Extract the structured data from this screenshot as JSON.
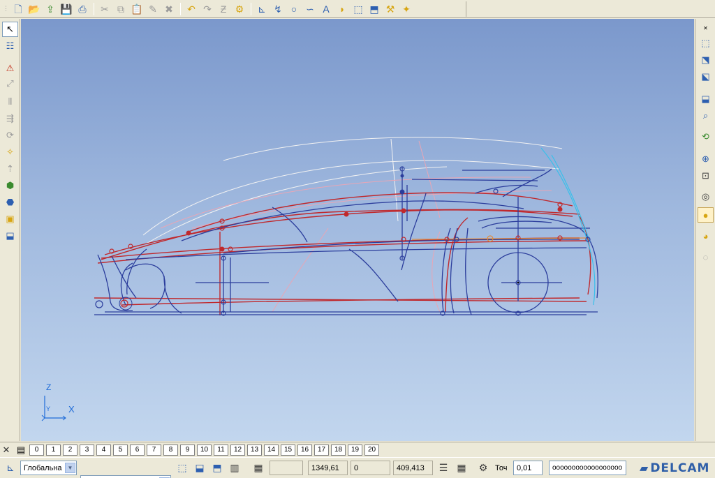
{
  "top_toolbar": {
    "icons": [
      "new-file-icon",
      "open-file-icon",
      "export-icon",
      "save-icon",
      "print-icon",
      "cut-icon",
      "copy-icon",
      "paste-icon",
      "edit-icon",
      "delete-icon",
      "undo-icon",
      "redo-icon",
      "zoom-icon",
      "model-icon",
      "point-tool-icon",
      "line-tool-icon",
      "circle-tool-icon",
      "arc-tool-icon",
      "text-tool-icon",
      "curve-tool-icon",
      "surface-tool-icon",
      "solid-tool-icon",
      "mechanism-tool-icon",
      "magic-wand-icon"
    ]
  },
  "left_toolbar": {
    "icons": [
      "select-arrow-icon",
      "object-info-icon",
      "warning-icon",
      "transform-icon",
      "mirror-icon",
      "distribute-icon",
      "rotate-icon",
      "morph-icon",
      "extrude-icon",
      "assembly-icon",
      "analysis-icon",
      "cube-icon",
      "shell-icon"
    ]
  },
  "right_toolbar": {
    "icons": [
      "view-iso-icon",
      "view-front-icon",
      "view-top-icon",
      "view-side-icon",
      "zoom-view-icon",
      "spin-view-icon",
      "fit-view-icon",
      "zoom-box-icon",
      "globe-icon",
      "shaded-sphere-icon",
      "shaded-sphere-lit-icon",
      "hidden-line-icon"
    ]
  },
  "viewport": {
    "background_top": "#7b98cc",
    "background_bottom": "#c2d6ee",
    "axis_labels": {
      "z": "Z",
      "y": "Y",
      "x": "X"
    }
  },
  "levels_bar": {
    "levels": [
      "0",
      "1",
      "2",
      "3",
      "4",
      "5",
      "6",
      "7",
      "8",
      "9",
      "10",
      "11",
      "12",
      "13",
      "14",
      "15",
      "16",
      "17",
      "18",
      "19",
      "20"
    ]
  },
  "status_bar": {
    "workplane": "Глобальна",
    "secondary_combo": "",
    "coord_x": "1349,61",
    "coord_y": "0",
    "coord_z": "409,413",
    "tolerance_label": "Точ",
    "tolerance_value": "0,01",
    "command_input": "oooooooooooooooooo",
    "brand": "DELCAM"
  },
  "colors": {
    "curve_red": "#c0282c",
    "curve_blue": "#2b3d9c",
    "curve_cyan": "#39c0ea",
    "curve_white": "#f2f2f2"
  }
}
